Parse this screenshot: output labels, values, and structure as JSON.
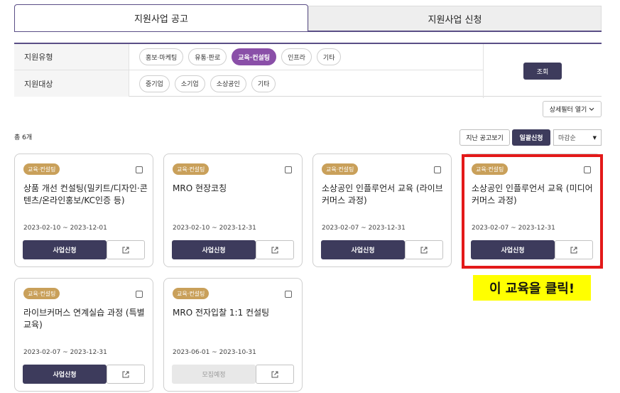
{
  "tabs": {
    "notice": "지원사업 공고",
    "apply": "지원사업 신청"
  },
  "filters": {
    "type_label": "지원유형",
    "type_options": [
      "홍보·마케팅",
      "유통·판로",
      "교육·컨설팅",
      "인프라",
      "기타"
    ],
    "type_selected": "교육·컨설팅",
    "target_label": "지원대상",
    "target_options": [
      "중기업",
      "소기업",
      "소상공인",
      "기타"
    ],
    "search_label": "조회"
  },
  "detail_filter_label": "상세필터 열기",
  "total_count": "총 6개",
  "toolbar": {
    "past_label": "지난 공고보기",
    "bulk_apply_label": "일괄신청",
    "sort_value": "마감순"
  },
  "cards": [
    {
      "badge": "교육·컨설팅",
      "title": "상품 개선 컨설팅(밀키트/디자인·콘텐츠/온라인홍보/KC인증 등)",
      "date": "2023-02-10 ~ 2023-12-01",
      "button": "사업신청",
      "disabled": false
    },
    {
      "badge": "교육·컨설팅",
      "title": "MRO 현장코칭",
      "date": "2023-02-10 ~ 2023-12-31",
      "button": "사업신청",
      "disabled": false
    },
    {
      "badge": "교육·컨설팅",
      "title": "소상공인 인플루언서 교육 (라이브커머스 과정)",
      "date": "2023-02-07 ~ 2023-12-31",
      "button": "사업신청",
      "disabled": false
    },
    {
      "badge": "교육·컨설팅",
      "title": "소상공인 인플루언서 교육 (미디어커머스 과정)",
      "date": "2023-02-07 ~ 2023-12-31",
      "button": "사업신청",
      "disabled": false
    },
    {
      "badge": "교육·컨설팅",
      "title": "라이브커머스 연계실습 과정 (특별교육)",
      "date": "2023-02-07 ~ 2023-12-31",
      "button": "사업신청",
      "disabled": false
    },
    {
      "badge": "교육·컨설팅",
      "title": "MRO 전자입찰 1:1 컨설팅",
      "date": "2023-06-01 ~ 2023-10-31",
      "button": "모집예정",
      "disabled": true
    }
  ],
  "annotation": "이 교육을 클릭!",
  "colors": {
    "primary": "#3d3b5c",
    "accent_purple": "#8a4fa8",
    "badge_gold": "#c9a05a",
    "highlight_red": "#e31919",
    "annotation_yellow": "#ffff00"
  }
}
